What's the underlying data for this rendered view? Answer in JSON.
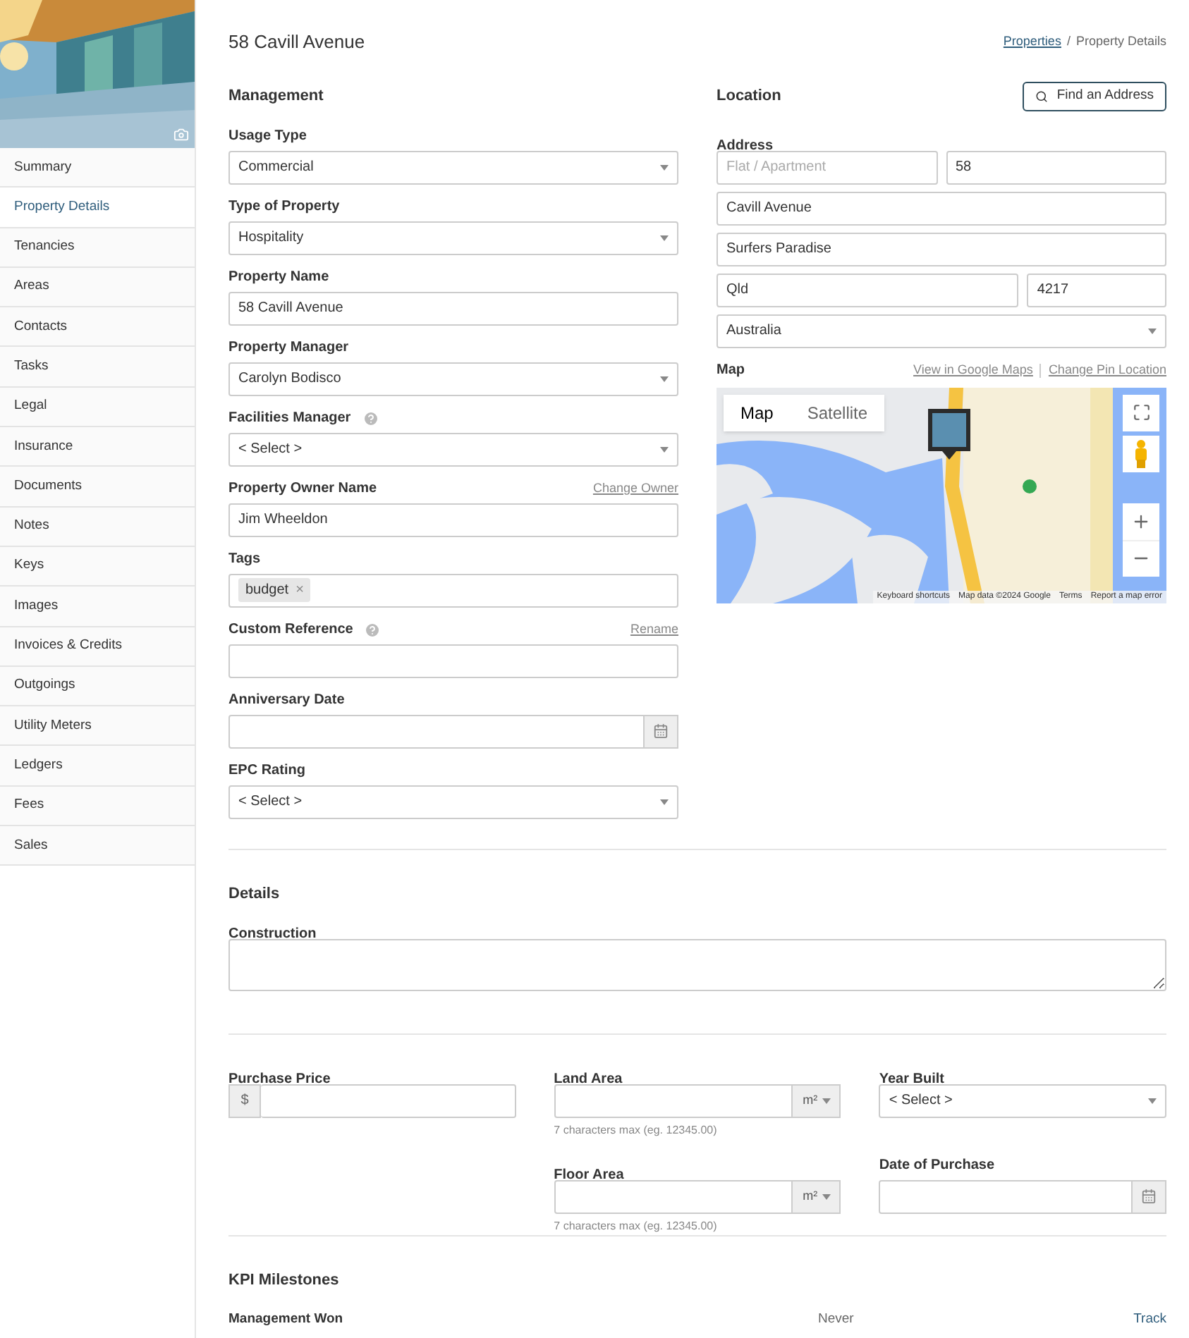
{
  "sidebar": {
    "items": [
      {
        "label": "Summary",
        "selected": false
      },
      {
        "label": "Property Details",
        "selected": true
      },
      {
        "label": "Tenancies",
        "selected": false
      },
      {
        "label": "Areas",
        "selected": false
      },
      {
        "label": "Contacts",
        "selected": false
      },
      {
        "label": "Tasks",
        "selected": false
      },
      {
        "label": "Legal",
        "selected": false
      },
      {
        "label": "Insurance",
        "selected": false
      },
      {
        "label": "Documents",
        "selected": false
      },
      {
        "label": "Notes",
        "selected": false
      },
      {
        "label": "Keys",
        "selected": false
      },
      {
        "label": "Images",
        "selected": false
      },
      {
        "label": "Invoices & Credits",
        "selected": false
      },
      {
        "label": "Outgoings",
        "selected": false
      },
      {
        "label": "Utility Meters",
        "selected": false
      },
      {
        "label": "Ledgers",
        "selected": false
      },
      {
        "label": "Fees",
        "selected": false
      },
      {
        "label": "Sales",
        "selected": false
      }
    ]
  },
  "page_title": "58 Cavill Avenue",
  "breadcrumb": {
    "link": "Properties",
    "separator": "/",
    "current": "Property Details"
  },
  "management": {
    "title": "Management",
    "fields": [
      {
        "kind": "select",
        "label": "Usage Type",
        "value": "Commercial"
      },
      {
        "kind": "select",
        "label": "Type of Property",
        "value": "Hospitality"
      },
      {
        "kind": "text",
        "label": "Property Name",
        "value": "58 Cavill Avenue"
      },
      {
        "kind": "select",
        "label": "Property Manager",
        "value": "Carolyn Bodisco"
      },
      {
        "kind": "select",
        "label": "Facilities Manager",
        "help": true,
        "value": "< Select >"
      },
      {
        "kind": "text",
        "label": "Property Owner Name",
        "link": "Change Owner",
        "value": "Jim Wheeldon"
      },
      {
        "kind": "tags",
        "label": "Tags",
        "tags": [
          "budget"
        ],
        "remove": "×"
      },
      {
        "kind": "text",
        "label": "Custom Reference",
        "help": true,
        "link": "Rename"
      },
      {
        "kind": "date",
        "label": "Anniversary Date"
      },
      {
        "kind": "select",
        "label": "EPC Rating",
        "value": "< Select >"
      }
    ]
  },
  "location": {
    "title": "Location",
    "find_button": "Find an Address",
    "address_label": "Address",
    "flat": {
      "placeholder": "Flat / Apartment"
    },
    "number": "58",
    "street": "Cavill Avenue",
    "suburb": "Surfers Paradise",
    "state": "Qld",
    "postcode": "4217",
    "country": "Australia",
    "map": {
      "label": "Map",
      "links": [
        "View in Google Maps",
        "Change Pin Location"
      ],
      "map_types": [
        {
          "label": "Map",
          "selected": true
        },
        {
          "label": "Satellite",
          "selected": false
        }
      ],
      "attribution": [
        "Keyboard shortcuts",
        "Map data ©2024 Google",
        "Terms",
        "Report a map error"
      ]
    }
  },
  "details": {
    "title": "Details",
    "construction_label": "Construction",
    "purchase_price": {
      "label": "Purchase Price",
      "prefix": "$"
    },
    "land_area": {
      "label": "Land Area",
      "unit": "m²",
      "hint": "7 characters max (eg. 12345.00)"
    },
    "year_built": {
      "label": "Year Built",
      "value": "< Select >"
    },
    "floor_area": {
      "label": "Floor Area",
      "unit": "m²",
      "hint": "7 characters max (eg. 12345.00)"
    },
    "date_of_purchase": {
      "label": "Date of Purchase"
    }
  },
  "kpi": {
    "title": "KPI Milestones",
    "rows": [
      {
        "label": "Management Won",
        "value": "Never",
        "action": "Track"
      }
    ]
  }
}
